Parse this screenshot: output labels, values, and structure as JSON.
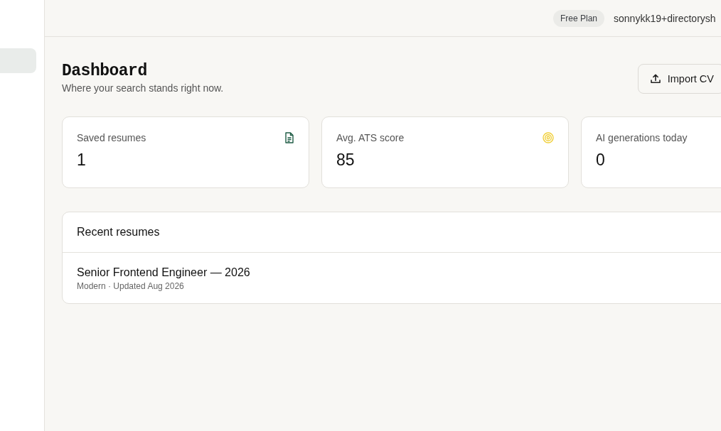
{
  "sidebar": {
    "items": [
      {
        "selected": true
      }
    ]
  },
  "header": {
    "plan_badge": "Free Plan",
    "user_email": "sonnykk19+directorysh"
  },
  "page": {
    "title": "Dashboard",
    "subtitle": "Where your search stands right now.",
    "import_button": "Import CV"
  },
  "stats": [
    {
      "label": "Saved resumes",
      "value": "1"
    },
    {
      "label": "Avg. ATS score",
      "value": "85"
    },
    {
      "label": "AI generations today",
      "value": "0"
    }
  ],
  "recent": {
    "title": "Recent resumes",
    "items": [
      {
        "title": "Senior Frontend Engineer — 2026",
        "meta": "Modern · Updated Aug 2026"
      }
    ]
  }
}
